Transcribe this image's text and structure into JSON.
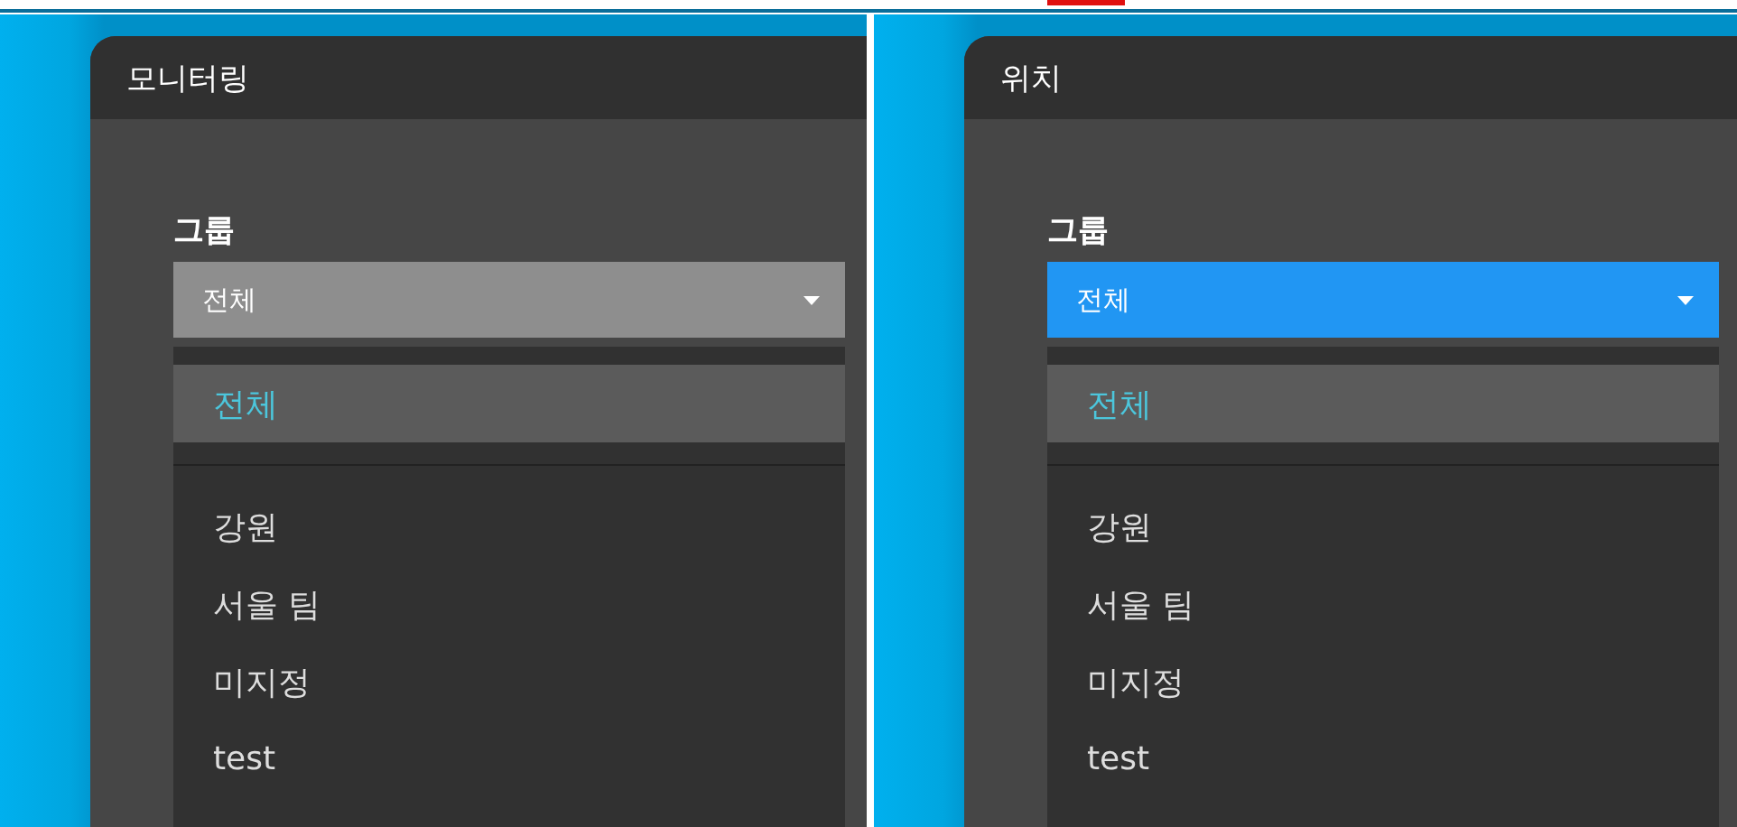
{
  "panels": [
    {
      "title": "모니터링",
      "field_label": "그룹",
      "select": {
        "value": "전체",
        "focused": false
      },
      "options": [
        {
          "label": "전체",
          "kind": "all",
          "selected": true
        },
        {
          "label": "강원",
          "kind": "group",
          "selected": false
        },
        {
          "label": "서울 팀",
          "kind": "group",
          "selected": false
        },
        {
          "label": "미지정",
          "kind": "group",
          "selected": false
        },
        {
          "label": "test",
          "kind": "group",
          "selected": false
        }
      ]
    },
    {
      "title": "위치",
      "field_label": "그룹",
      "select": {
        "value": "전체",
        "focused": true
      },
      "options": [
        {
          "label": "전체",
          "kind": "all",
          "selected": true
        },
        {
          "label": "강원",
          "kind": "group",
          "selected": false
        },
        {
          "label": "서울 팀",
          "kind": "group",
          "selected": false
        },
        {
          "label": "미지정",
          "kind": "group",
          "selected": false
        },
        {
          "label": "test",
          "kind": "group",
          "selected": false
        }
      ]
    }
  ]
}
